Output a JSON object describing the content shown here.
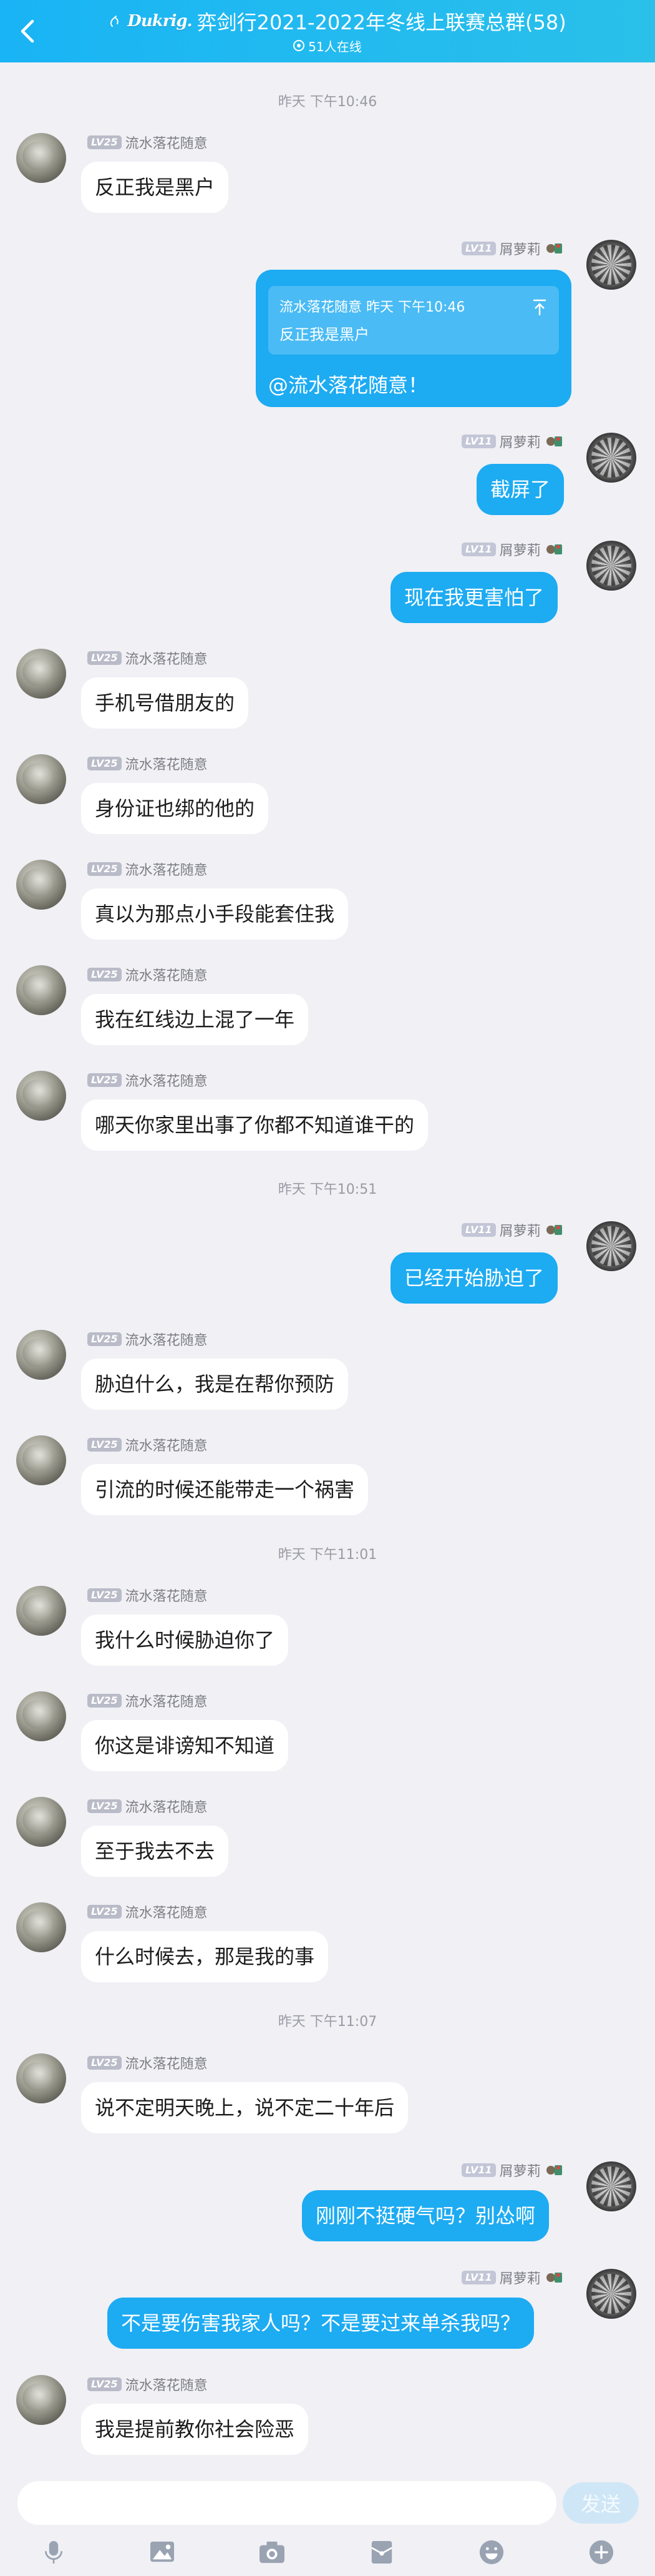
{
  "header": {
    "brand": "Dukrig.",
    "title": "弈剑行2021-2022年冬线上联赛总群(58)",
    "online": "51人在线"
  },
  "time_separators": [
    "昨天 下午10:46",
    "昨天 下午10:51",
    "昨天 下午11:01",
    "昨天 下午11:07"
  ],
  "users": {
    "other": {
      "name": "流水落花随意",
      "level": "LV25"
    },
    "me": {
      "name": "屑萝莉",
      "level": "LV11"
    }
  },
  "quote": {
    "meta": "流水落花随意 昨天 下午10:46",
    "text": "反正我是黑户",
    "reply": "@流水落花随意！"
  },
  "messages": [
    {
      "text": "反正我是黑户"
    },
    {
      "text": "截屏了"
    },
    {
      "text": "现在我更害怕了"
    },
    {
      "text": "手机号借朋友的"
    },
    {
      "text": "身份证也绑的他的"
    },
    {
      "text": "真以为那点小手段能套住我"
    },
    {
      "text": "我在红线边上混了一年"
    },
    {
      "text": "哪天你家里出事了你都不知道谁干的"
    },
    {
      "text": "已经开始胁迫了"
    },
    {
      "text": "胁迫什么，我是在帮你预防"
    },
    {
      "text": "引流的时候还能带走一个祸害"
    },
    {
      "text": "我什么时候胁迫你了"
    },
    {
      "text": "你这是诽谤知不知道"
    },
    {
      "text": "至于我去不去"
    },
    {
      "text": "什么时候去，那是我的事"
    },
    {
      "text": "说不定明天晚上，说不定二十年后"
    },
    {
      "text": "刚刚不挺硬气吗？别怂啊"
    },
    {
      "text": "不是要伤害我家人吗？不是要过来单杀我吗？"
    },
    {
      "text": "我是提前教你社会险恶"
    }
  ],
  "input": {
    "value": "",
    "send_label": "发送"
  },
  "toolbar": [
    "mic-icon",
    "image-icon",
    "camera-icon",
    "red-packet-icon",
    "emoji-icon",
    "plus-icon"
  ]
}
